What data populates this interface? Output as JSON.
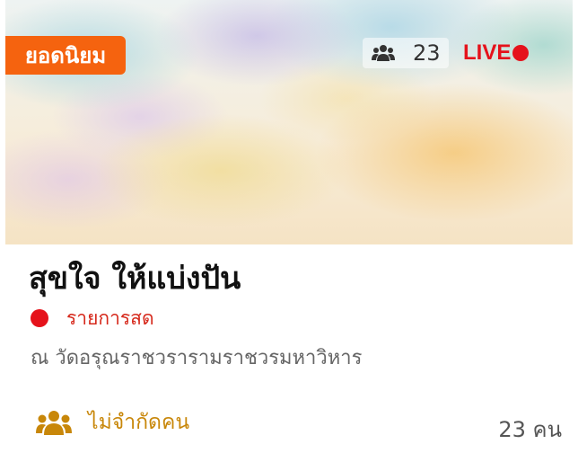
{
  "badge": {
    "label": "ยอดนิยม"
  },
  "viewers": {
    "count": "23",
    "icon": "users-icon"
  },
  "live": {
    "label": "LIVE",
    "color": "#e5121b"
  },
  "event": {
    "title": "สุขใจ ให้แบ่งปัน",
    "status": "รายการสด",
    "location": "ณ วัดอรุณราชวรารามราชวรมหาวิหาร",
    "capacity": "ไม่จำกัดคน",
    "attendees": "23 คน"
  },
  "colors": {
    "accent": "#f5630f",
    "live": "#e5121b",
    "capacity": "#c8870a"
  }
}
